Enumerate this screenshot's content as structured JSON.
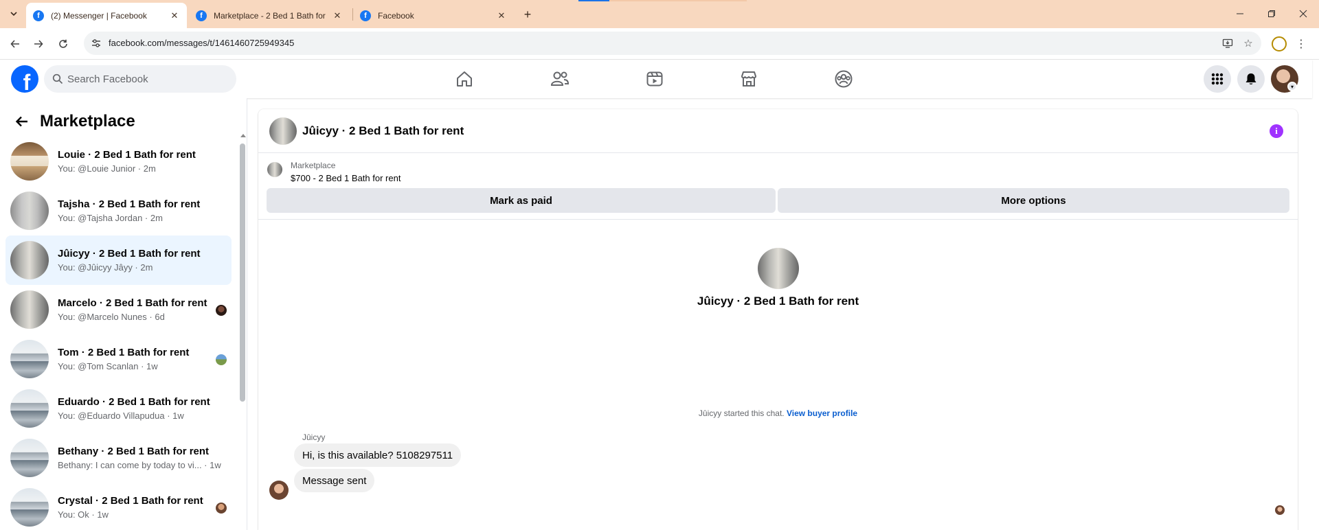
{
  "browser": {
    "tabs": [
      {
        "title": "(2) Messenger | Facebook",
        "favicon": "facebook-icon",
        "active": true
      },
      {
        "title": "Marketplace - 2 Bed 1 Bath for",
        "favicon": "facebook-icon",
        "active": false
      },
      {
        "title": "Facebook",
        "favicon": "facebook-icon",
        "active": false
      }
    ],
    "url": "facebook.com/messages/t/1461460725949345",
    "accent": "#1a73e8",
    "frame_color": "#f8d8bf"
  },
  "fb": {
    "logo": "f",
    "search_placeholder": "Search Facebook",
    "brand_color": "#0866ff"
  },
  "sidebar": {
    "title": "Marketplace",
    "conversations": [
      {
        "name": "Louie · 2 Bed 1 Bath for rent",
        "sub": "You: @Louie Junior · 2m",
        "art": "bedroom",
        "selected": false
      },
      {
        "name": "Tajsha · 2 Bed 1 Bath for rent",
        "sub": "You: @Tajsha Jordan · 2m",
        "art": "hall",
        "selected": false
      },
      {
        "name": "Jûicyy · 2 Bed 1 Bath for rent",
        "sub": "You: @Jûicyy Jâyy · 2m",
        "art": "hall2",
        "selected": true
      },
      {
        "name": "Marcelo · 2 Bed 1 Bath for rent",
        "sub": "You: @Marcelo Nunes · 6d",
        "art": "hall2",
        "selected": false
      },
      {
        "name": "Tom · 2 Bed 1 Bath for rent",
        "sub": "You: @Tom Scanlan · 1w",
        "art": "house",
        "selected": false
      },
      {
        "name": "Eduardo · 2 Bed 1 Bath for rent",
        "sub": "You: @Eduardo Villapudua · 1w",
        "art": "house",
        "selected": false
      },
      {
        "name": "Bethany · 2 Bed 1 Bath for rent",
        "sub": "Bethany: I can come by today to vi... · 1w",
        "art": "house",
        "selected": false
      },
      {
        "name": "Crystal · 2 Bed 1 Bath for rent",
        "sub": "You: Ok · 1w",
        "art": "house",
        "selected": false
      }
    ]
  },
  "chat": {
    "title": "Jûicyy · 2 Bed 1 Bath for rent",
    "listing_source": "Marketplace",
    "listing_price": "$700 - 2 Bed 1 Bath for rent",
    "mark_paid_label": "Mark as paid",
    "more_options_label": "More options",
    "intro_name": "Jûicyy · 2 Bed 1 Bath for rent",
    "started_text": "Jûicyy started this chat.",
    "view_profile_label": "View buyer profile",
    "sender_name": "Jûicyy",
    "messages": [
      {
        "text": "Hi, is this available? 5108297511"
      },
      {
        "text": "Message sent"
      }
    ],
    "info_color": "#a033ff"
  }
}
